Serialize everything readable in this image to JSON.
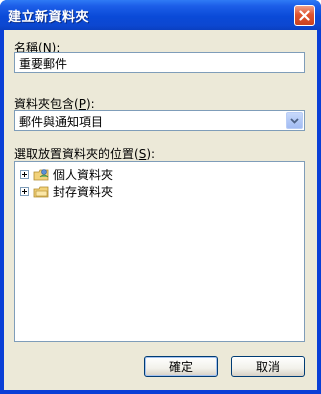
{
  "window": {
    "title": "建立新資料夾"
  },
  "name_field": {
    "label": "名稱(N):",
    "label_text": "名稱(",
    "label_accel": "N",
    "label_tail": "):",
    "value": "重要郵件"
  },
  "contains_field": {
    "label_text": "資料夾包含(",
    "label_accel": "P",
    "label_tail": "):",
    "selected": "郵件與通知項目"
  },
  "location_field": {
    "label_text": "選取放置資料夾的位置(",
    "label_accel": "S",
    "label_tail": "):",
    "items": [
      {
        "label": "個人資料夾",
        "icon": "personal-folders-icon"
      },
      {
        "label": "封存資料夾",
        "icon": "archive-folders-icon"
      }
    ]
  },
  "buttons": {
    "ok": "確定",
    "cancel": "取消"
  },
  "colors": {
    "titlebar": "#0a4ad8",
    "client": "#ece9d8",
    "field_border": "#7f9db9"
  }
}
